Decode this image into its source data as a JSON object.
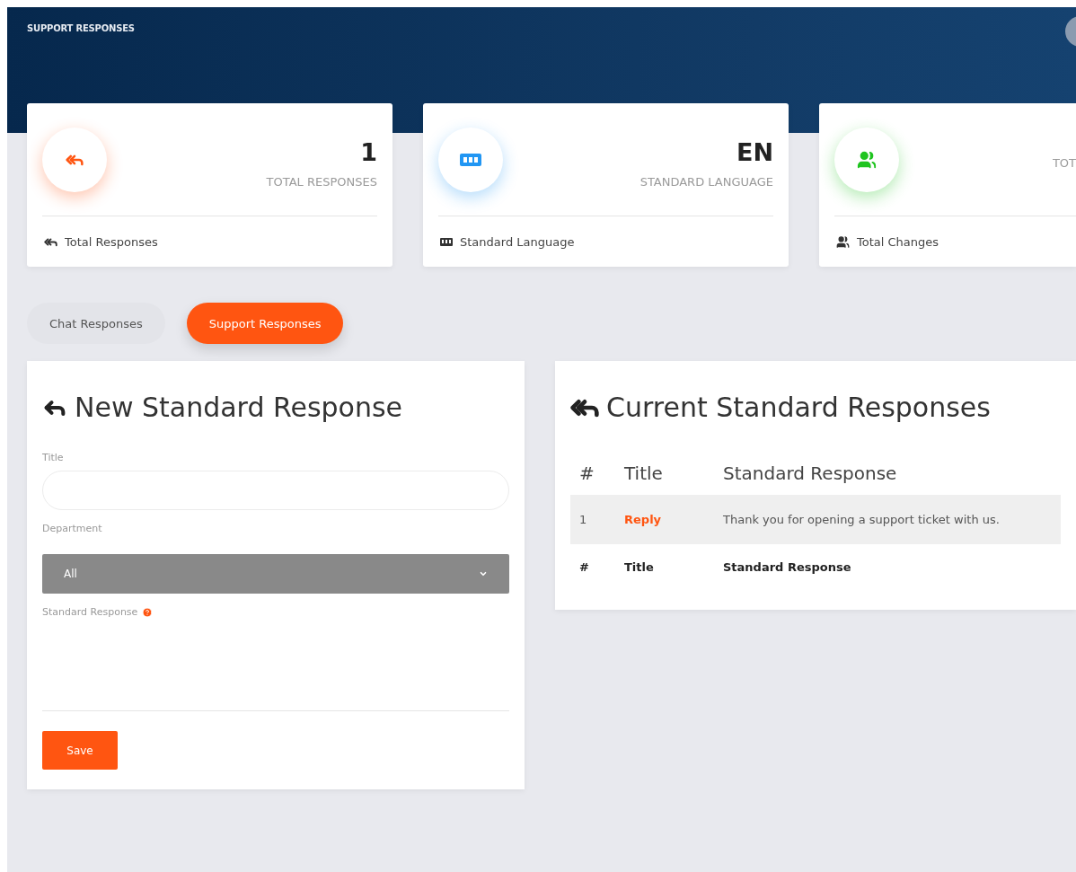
{
  "header": {
    "title": "SUPPORT RESPONSES"
  },
  "stats": [
    {
      "kind": "responses",
      "value": "1",
      "label": "TOTAL RESPONSES",
      "footer": "Total Responses",
      "color": "#ff5511"
    },
    {
      "kind": "language",
      "value": "EN",
      "label": "STANDARD LANGUAGE",
      "footer": "Standard Language",
      "color": "#2196f3"
    },
    {
      "kind": "changes",
      "label": "TOT",
      "footer": "Total Changes",
      "color": "#1fc41f"
    }
  ],
  "tabs": [
    {
      "label": "Chat Responses",
      "selected": false
    },
    {
      "label": "Support Responses",
      "selected": true
    }
  ],
  "form": {
    "heading": "New Standard Response",
    "fields": [
      {
        "kind": "text",
        "label": "Title"
      },
      {
        "kind": "select",
        "label": "Department",
        "value": "All"
      },
      {
        "kind": "textarea",
        "label": "Standard Response",
        "help": true
      }
    ],
    "button": "Save"
  },
  "table": {
    "heading": "Current Standard Responses",
    "columns": [
      "#",
      "Title",
      "Standard Response"
    ],
    "rows": [
      {
        "cells": [
          "1",
          "Reply",
          "Thank you for opening a support ticket with us."
        ]
      }
    ],
    "footer": [
      "#",
      "Title",
      "Standard Response"
    ]
  }
}
